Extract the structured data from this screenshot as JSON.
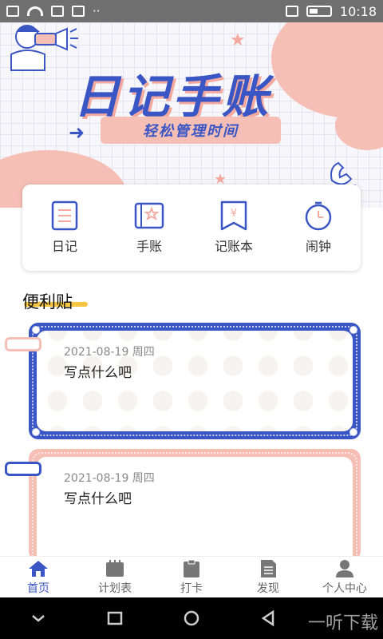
{
  "status_bar": {
    "time": "10:18"
  },
  "hero": {
    "title": "日记手账",
    "subtitle": "轻松管理时间"
  },
  "quick_menu": [
    {
      "label": "日记",
      "icon": "diary-icon"
    },
    {
      "label": "手账",
      "icon": "notebook-icon"
    },
    {
      "label": "记账本",
      "icon": "ledger-icon"
    },
    {
      "label": "闹钟",
      "icon": "alarm-icon"
    }
  ],
  "section": {
    "title": "便利贴"
  },
  "notes": [
    {
      "date": "2021-08-19 周四",
      "text": "写点什么吧"
    },
    {
      "date": "2021-08-19 周四",
      "text": "写点什么吧"
    }
  ],
  "bottom_nav": [
    {
      "label": "首页",
      "icon": "home-icon",
      "active": true
    },
    {
      "label": "计划表",
      "icon": "calendar-icon",
      "active": false
    },
    {
      "label": "打卡",
      "icon": "clipboard-icon",
      "active": false
    },
    {
      "label": "发现",
      "icon": "document-icon",
      "active": false
    },
    {
      "label": "个人中心",
      "icon": "user-icon",
      "active": false
    }
  ],
  "watermark": "一听下载",
  "colors": {
    "accent": "#3a56c5",
    "pink": "#f6bfb6",
    "highlight": "#f6c642"
  }
}
